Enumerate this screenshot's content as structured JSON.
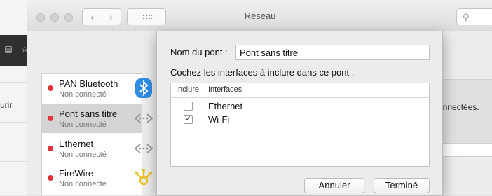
{
  "background": {
    "left_fragment_text": "urir",
    "right_fragment_text": "onnectées."
  },
  "window": {
    "title": "Réseau",
    "nav": {
      "back_glyph": "‹",
      "forward_glyph": "›"
    }
  },
  "services": [
    {
      "name": "PAN Bluetooth",
      "status": "Non connecté",
      "icon": "bluetooth-icon",
      "status_color": "#e0333a"
    },
    {
      "name": "Pont sans titre",
      "status": "Non connecté",
      "icon": "bridge-arrows-icon",
      "status_color": "#e0333a",
      "selected": true
    },
    {
      "name": "Ethernet",
      "status": "Non connecté",
      "icon": "ethernet-arrows-icon",
      "status_color": "#e0333a"
    },
    {
      "name": "FireWire",
      "status": "Non connecté",
      "icon": "firewire-icon",
      "status_color": "#e0333a"
    }
  ],
  "sheet": {
    "name_label": "Nom du pont :",
    "name_value": "Pont sans titre",
    "check_label": "Cochez les interfaces à inclure dans ce pont :",
    "table": {
      "col_include": "Inclure",
      "col_interfaces": "Interfaces",
      "rows": [
        {
          "name": "Ethernet",
          "checked": false
        },
        {
          "name": "Wi-Fi",
          "checked": true
        }
      ]
    },
    "cancel_label": "Annuler",
    "done_label": "Terminé"
  }
}
